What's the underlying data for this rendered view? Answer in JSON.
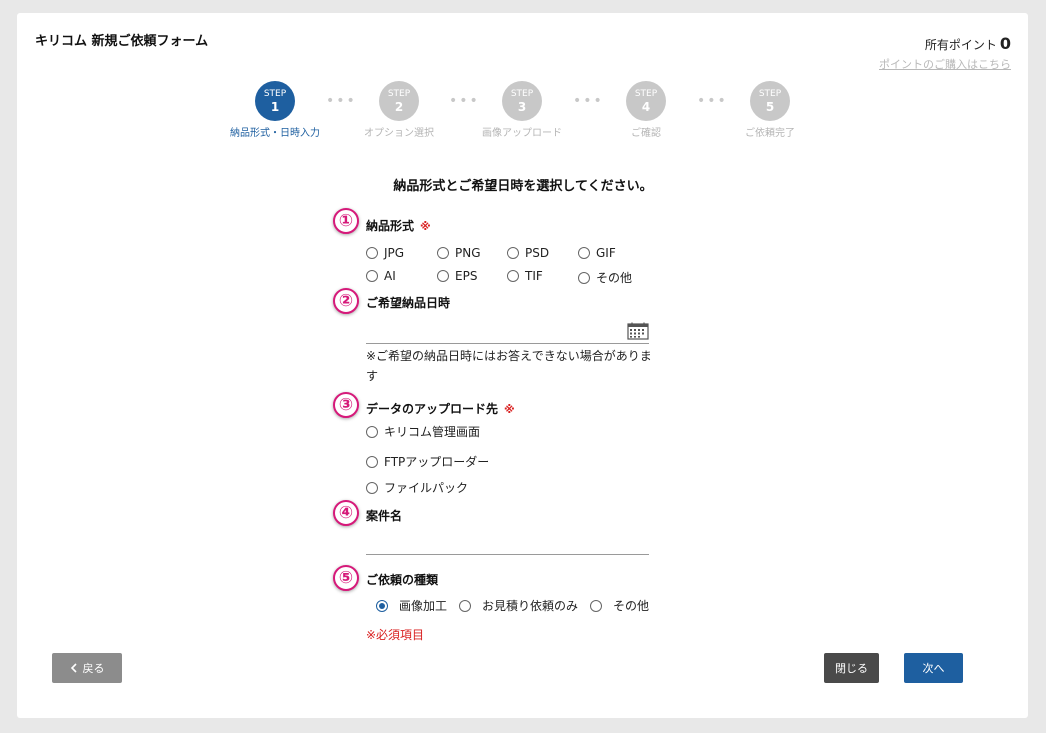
{
  "header": {
    "title": "キリコム 新規ご依頼フォーム",
    "points_label": "所有ポイント",
    "points_value": "0",
    "points_link": "ポイントのご購入はこちら"
  },
  "steps": [
    {
      "step": "STEP",
      "number": "1",
      "label": "納品形式・日時入力",
      "active": true
    },
    {
      "step": "STEP",
      "number": "2",
      "label": "オプション選択",
      "active": false
    },
    {
      "step": "STEP",
      "number": "3",
      "label": "画像アップロード",
      "active": false
    },
    {
      "step": "STEP",
      "number": "4",
      "label": "ご確認",
      "active": false
    },
    {
      "step": "STEP",
      "number": "5",
      "label": "ご依頼完了",
      "active": false
    }
  ],
  "step_separator": "•••",
  "heading": "納品形式とご希望日時を選択してください。",
  "badges": [
    "①",
    "②",
    "③",
    "④",
    "⑤"
  ],
  "required_mark": "※",
  "q1": {
    "label": "納品形式",
    "options": [
      "JPG",
      "PNG",
      "PSD",
      "GIF",
      "AI",
      "EPS",
      "TIF",
      "その他"
    ]
  },
  "q2": {
    "label": "ご希望納品日時",
    "value": "",
    "note": "※ご希望の納品日時にはお答えできない場合があります"
  },
  "q3": {
    "label": "データのアップロード先",
    "options": [
      "キリコム管理画面",
      "FTPアップローダー",
      "ファイルパック"
    ]
  },
  "q4": {
    "label": "案件名",
    "value": ""
  },
  "q5": {
    "label": "ご依頼の種類",
    "options": [
      "画像加工",
      "お見積り依頼のみ",
      "その他"
    ],
    "selected": "画像加工"
  },
  "required_note": "※必須項目",
  "buttons": {
    "back_icon": "chevron-left-icon",
    "back": "戻る",
    "close": "閉じる",
    "next": "次へ"
  },
  "colors": {
    "accent": "#1e5fa0",
    "badge": "#d6197a",
    "required": "#d92020"
  }
}
